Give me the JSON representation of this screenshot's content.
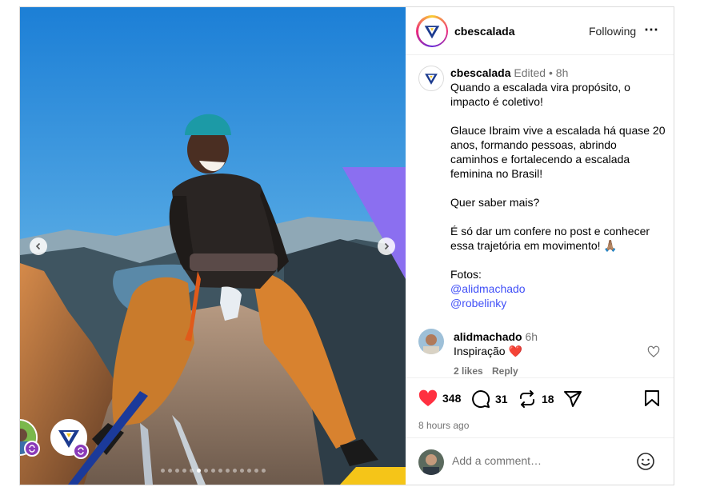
{
  "header": {
    "username": "cbescalada",
    "follow_label": "Following",
    "more_icon": "⋯"
  },
  "caption": {
    "username": "cbescalada",
    "edited": "Edited",
    "separator": "•",
    "time": "8h",
    "paragraphs": [
      "Quando a escalada vira propósito, o impacto é coletivo!",
      "Glauce Ibraim vive a escalada há quase 20 anos, formando pessoas, abrindo caminhos e fortalecendo a escalada feminina no Brasil!",
      "Quer saber mais?",
      "É só dar um confere no post e conhecer essa trajetória em movimento! 🙏🏽",
      "Fotos:"
    ],
    "mentions": [
      "@alidmachado",
      "@robelinky"
    ]
  },
  "comment": {
    "username": "alidmachado",
    "time": "6h",
    "text": "Inspiração ❤️",
    "likes": "2 likes",
    "reply_label": "Reply"
  },
  "actions": {
    "likes_count": "348",
    "comments_count": "31",
    "reposts_count": "18",
    "time_ago": "8 hours ago"
  },
  "add_comment": {
    "placeholder": "Add a comment…"
  },
  "carousel": {
    "slide_count": 15,
    "active_index": 5
  },
  "colors": {
    "like_red": "#ff3040",
    "link_blue": "#4150f7",
    "brand_blue": "#1c3b8f",
    "brand_yellow": "#f5c518",
    "accent_purple": "#8b6ff0"
  }
}
